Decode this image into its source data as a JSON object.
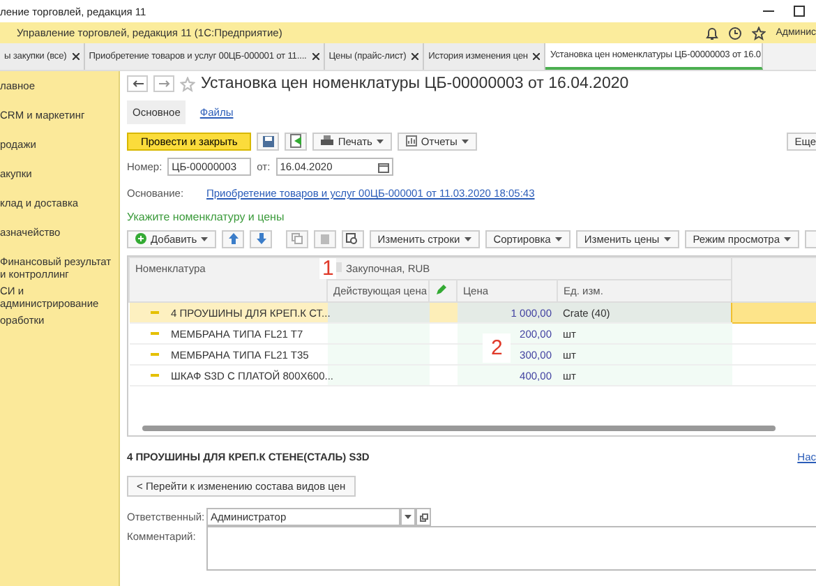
{
  "window": {
    "title": "ление торговлей, редакция 11"
  },
  "app_bar": {
    "title": "Управление торговлей, редакция 11  (1С:Предприятие)",
    "user": "Админис"
  },
  "tabs": [
    {
      "label": "ы закупки (все)",
      "selected": false
    },
    {
      "label": "Приобретение товаров и услуг 00ЦБ-000001 от 11....",
      "selected": false
    },
    {
      "label": "Цены (прайс-лист)",
      "selected": false
    },
    {
      "label": "История изменения цен",
      "selected": false
    },
    {
      "label": "Установка цен номенклатуры ЦБ-00000003 от 16.0",
      "selected": true
    }
  ],
  "sidebar": {
    "items": [
      {
        "label": "лавное"
      },
      {
        "label": "CRM и маркетинг"
      },
      {
        "label": "родажи"
      },
      {
        "label": "акупки"
      },
      {
        "label": "клад и доставка"
      },
      {
        "label": "азначейство"
      },
      {
        "label": "Финансовый результат и контроллинг"
      },
      {
        "label": "СИ и администрирование"
      },
      {
        "label": "оработки"
      }
    ]
  },
  "document": {
    "title": "Установка цен номенклатуры ЦБ-00000003 от 16.04.2020",
    "sections": [
      {
        "label": "Основное",
        "selected": true
      },
      {
        "label": "Файлы",
        "selected": false
      }
    ]
  },
  "toolbar": {
    "primary": "Провести и закрыть",
    "print": "Печать",
    "reports": "Отчеты",
    "more": "Еще"
  },
  "fields": {
    "number_label": "Номер:",
    "number": "ЦБ-00000003",
    "date_label": "от:",
    "date": "16.04.2020",
    "basis_label": "Основание:",
    "basis_link": "Приобретение товаров и услуг 00ЦБ-000001 от 11.03.2020 18:05:43"
  },
  "section_heading": "Укажите номенклатуру и цены",
  "table_toolbar": {
    "add": "Добавить",
    "buttons": [
      "Изменить строки",
      "Сортировка",
      "Изменить цены",
      "Режим просмотра"
    ]
  },
  "table": {
    "columns": {
      "item": "Номенклатура",
      "group": "Закупочная, RUB",
      "current": "Действующая цена",
      "price": "Цена",
      "unit": "Ед. изм."
    },
    "rows": [
      {
        "item": "4 ПРОУШИНЫ ДЛЯ КРЕП.К СТ...",
        "price": "1 000,00",
        "unit": "Crate (40)",
        "selected": true
      },
      {
        "item": "МЕМБРАНА ТИПА FL21 T7",
        "price": "200,00",
        "unit": "шт",
        "selected": false
      },
      {
        "item": "МЕМБРАНА ТИПА FL21 T35",
        "price": "300,00",
        "unit": "шт",
        "selected": false
      },
      {
        "item": "ШКАФ S3D С ПЛАТОЙ 800X600...",
        "price": "400,00",
        "unit": "шт",
        "selected": false
      }
    ]
  },
  "annotations": [
    "1",
    "2"
  ],
  "selected_item": "4 ПРОУШИНЫ ДЛЯ КРЕП.К СТЕНЕ(СТАЛЬ) S3D",
  "settings_link": "Нас",
  "change_button": "< Перейти к изменению состава видов цен",
  "responsible": {
    "label": "Ответственный:",
    "value": "Администратор"
  },
  "comment": {
    "label": "Комментарий:"
  }
}
